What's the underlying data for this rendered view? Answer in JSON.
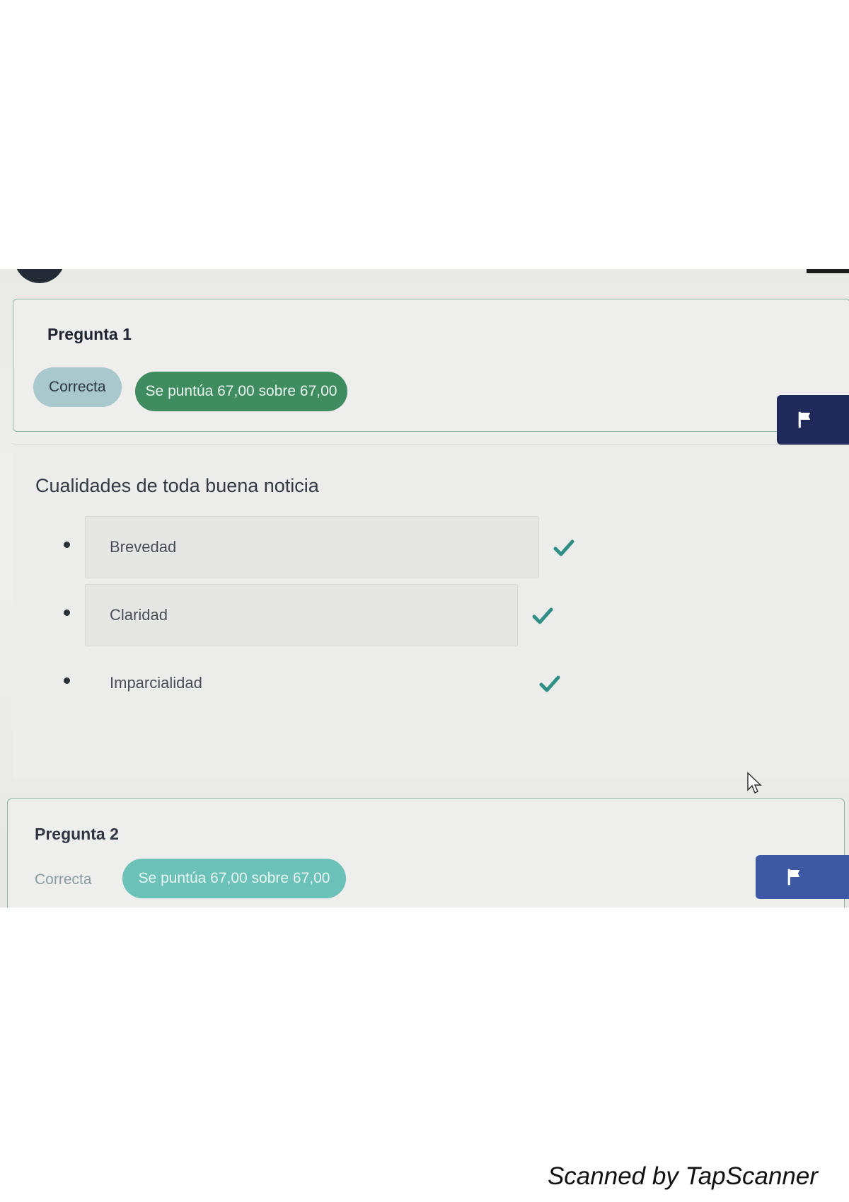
{
  "questions": [
    {
      "title": "Pregunta 1",
      "status": "Correcta",
      "score": "Se puntúa 67,00 sobre 67,00",
      "question_text": "Cualidades de toda buena noticia",
      "answers": [
        "Brevedad",
        "Claridad",
        "Imparcialidad"
      ]
    },
    {
      "title": "Pregunta 2",
      "status": "Correcta",
      "score": "Se puntúa 67,00 sobre 67,00"
    }
  ],
  "footer": {
    "watermark": "Scanned by TapScanner"
  },
  "colors": {
    "correct_badge": "#a9c8cd",
    "score_badge": "#3f8c60",
    "flag_button": "#1f2a5a",
    "checkmark": "#2f8f86"
  },
  "icons": [
    "flag-icon",
    "check-icon",
    "cursor-icon"
  ]
}
